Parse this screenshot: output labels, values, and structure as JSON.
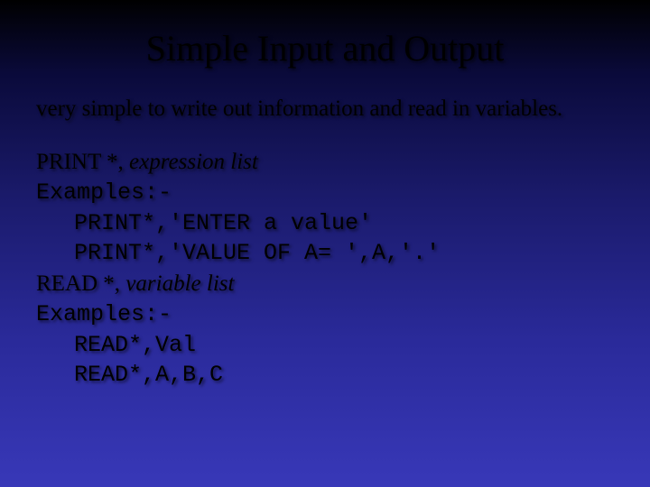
{
  "title": "Simple Input and Output",
  "intro": "very simple to write out information and read in variables.",
  "line1_prefix": "PRINT *, ",
  "line1_italic": "expression list",
  "line2": "Examples:-",
  "line3": "PRINT*,'ENTER a value'",
  "line4": "PRINT*,'VALUE OF A= ',A,'.'",
  "line5_prefix": "READ *, ",
  "line5_italic": "variable list",
  "line6": "Examples:-",
  "line7": "READ*,Val",
  "line8": "READ*,A,B,C"
}
